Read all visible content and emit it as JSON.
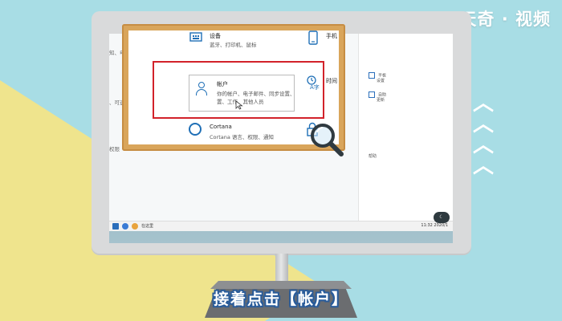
{
  "brand": {
    "name": "天奇 · 视频"
  },
  "settings_window": {
    "left_rows": [
      "知、电源",
      "、可选功能",
      "权限"
    ],
    "right_col": {
      "items": [
        "手机",
        "时间",
        "设备"
      ],
      "tiny": [
        "平板",
        "设置",
        "自助",
        "更新",
        "帮助"
      ]
    }
  },
  "overlay": {
    "devices": {
      "title": "设备",
      "subtitle": "蓝牙、打印机、鼠标"
    },
    "phone": {
      "title": "手机"
    },
    "accounts": {
      "title": "帐户",
      "subtitle_line1": "你的帐户、电子邮件、同步设置、",
      "subtitle_line2": "置、工作、其他人员"
    },
    "time": {
      "title": "时间"
    },
    "cortana": {
      "title": "Cortana",
      "subtitle": "Cortana 语言、权限、通知"
    }
  },
  "taskbar": {
    "search_text": "在这里",
    "clock": "11:32 2020/1"
  },
  "toggle_badge": "☾",
  "caption": {
    "text": "接着点击【帐户】"
  },
  "colors": {
    "accent_blue": "#1f6fb6",
    "highlight_red": "#d2222a",
    "caption_outline": "#2a5c9a",
    "frame_wood": "#d9a55b"
  },
  "icons": [
    "devices-icon",
    "phone-icon",
    "person-icon",
    "time-language-icon",
    "cortana-icon",
    "privacy-lock-icon",
    "magnifier-icon",
    "mouse-cursor-icon",
    "chevron-up-icon"
  ]
}
